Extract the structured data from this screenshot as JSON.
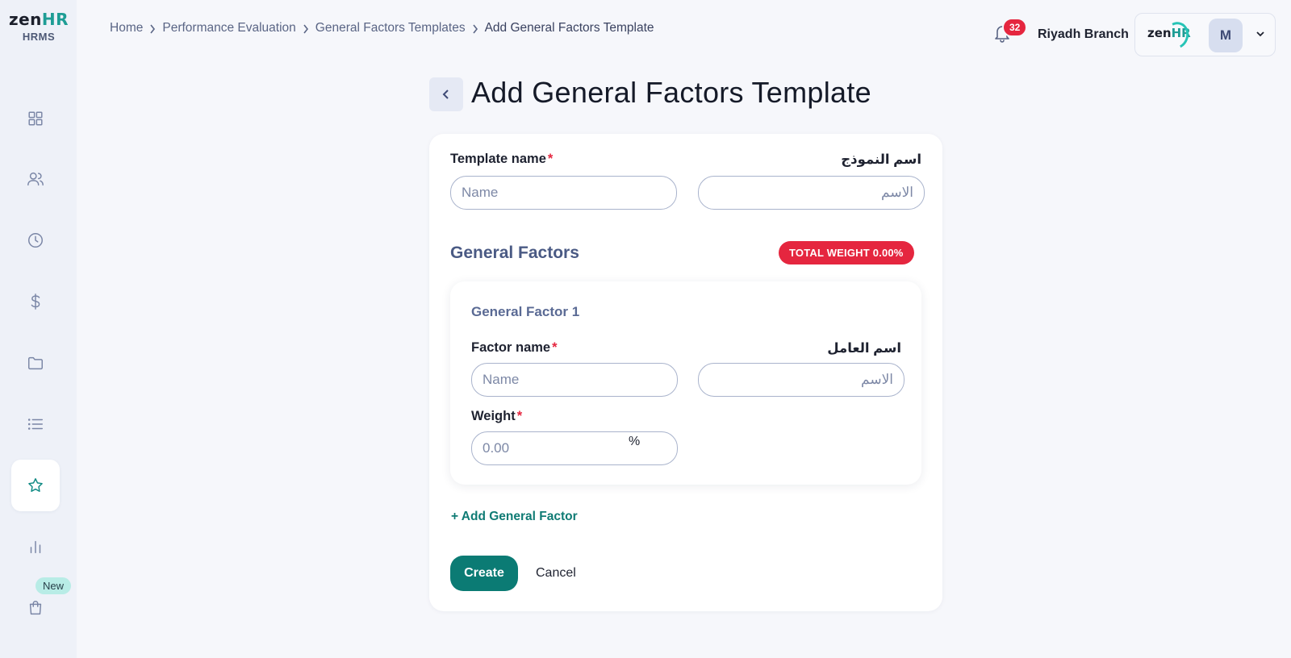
{
  "sidebar": {
    "logo": {
      "zen": "zen",
      "hr": "HR",
      "sub": "HRMS"
    },
    "items": [
      {
        "name": "dashboard-icon"
      },
      {
        "name": "users-icon"
      },
      {
        "name": "clock-icon"
      },
      {
        "name": "dollar-icon"
      },
      {
        "name": "folder-icon"
      },
      {
        "name": "list-icon"
      },
      {
        "name": "star-icon",
        "active": true
      },
      {
        "name": "bar-chart-icon"
      },
      {
        "name": "shopping-bag-icon"
      }
    ],
    "new_badge": "New"
  },
  "header": {
    "breadcrumb": [
      "Home",
      "Performance Evaluation",
      "General Factors Templates",
      "Add General Factors Template"
    ],
    "notification_count": "32",
    "branch": "Riyadh Branch",
    "account": {
      "logo_zen": "zen",
      "logo_hr": "HR",
      "avatar_initial": "M"
    }
  },
  "page": {
    "title": "Add General Factors Template"
  },
  "form": {
    "template_name_label": "Template name",
    "template_name_label_ar": "اسم النموذج",
    "template_name_placeholder": "Name",
    "template_name_placeholder_ar": "الاسم",
    "template_name_value": "",
    "template_name_value_ar": "",
    "required_mark": "*",
    "section_title": "General Factors",
    "total_weight": "TOTAL WEIGHT 0.00%",
    "factors": [
      {
        "title": "General Factor 1",
        "name_label": "Factor name",
        "name_label_ar": "اسم العامل",
        "name_placeholder": "Name",
        "name_placeholder_ar": "الاسم",
        "weight_label": "Weight",
        "weight_placeholder": "0.00",
        "weight_unit": "%"
      }
    ],
    "add_factor_label": "+ Add General Factor",
    "create_label": "Create",
    "cancel_label": "Cancel"
  },
  "colors": {
    "accent": "#0b7b74",
    "danger": "#e5263f",
    "sidebar_bg": "#eef1f8",
    "page_bg": "#f6f7fb"
  }
}
